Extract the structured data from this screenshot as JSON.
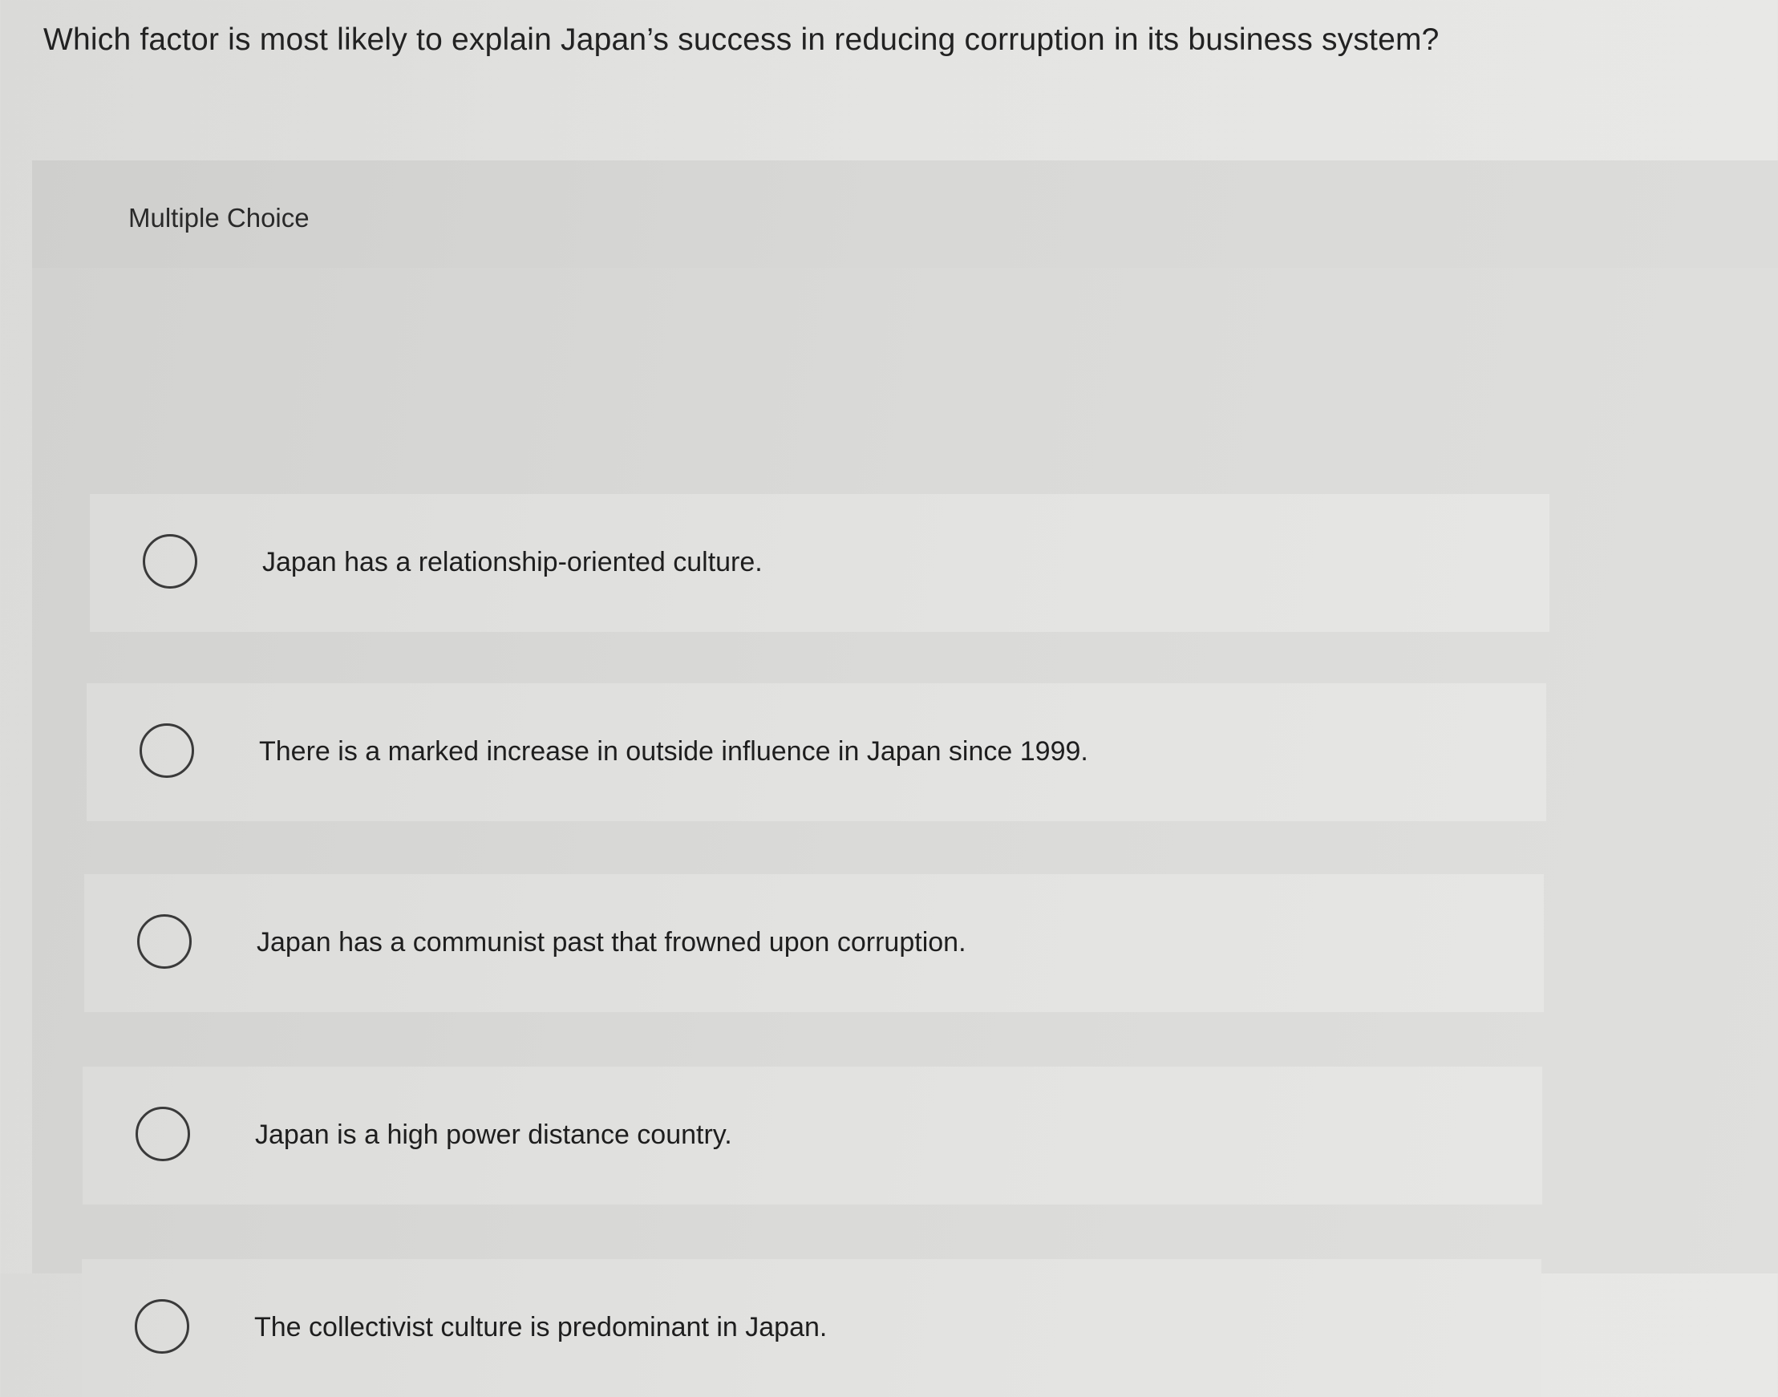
{
  "question": {
    "text": "Which factor is most likely to explain Japan’s success in reducing corruption in its business system?"
  },
  "panel": {
    "label": "Multiple Choice"
  },
  "options": [
    {
      "text": "Japan has a relationship-oriented culture.",
      "selected": false
    },
    {
      "text": "There is a marked increase in outside influence in Japan since 1999.",
      "selected": false
    },
    {
      "text": "Japan has a communist past that frowned upon corruption.",
      "selected": false
    },
    {
      "text": "Japan is a high power distance country.",
      "selected": false
    },
    {
      "text": "The collectivist culture is predominant in Japan.",
      "selected": false
    }
  ]
}
